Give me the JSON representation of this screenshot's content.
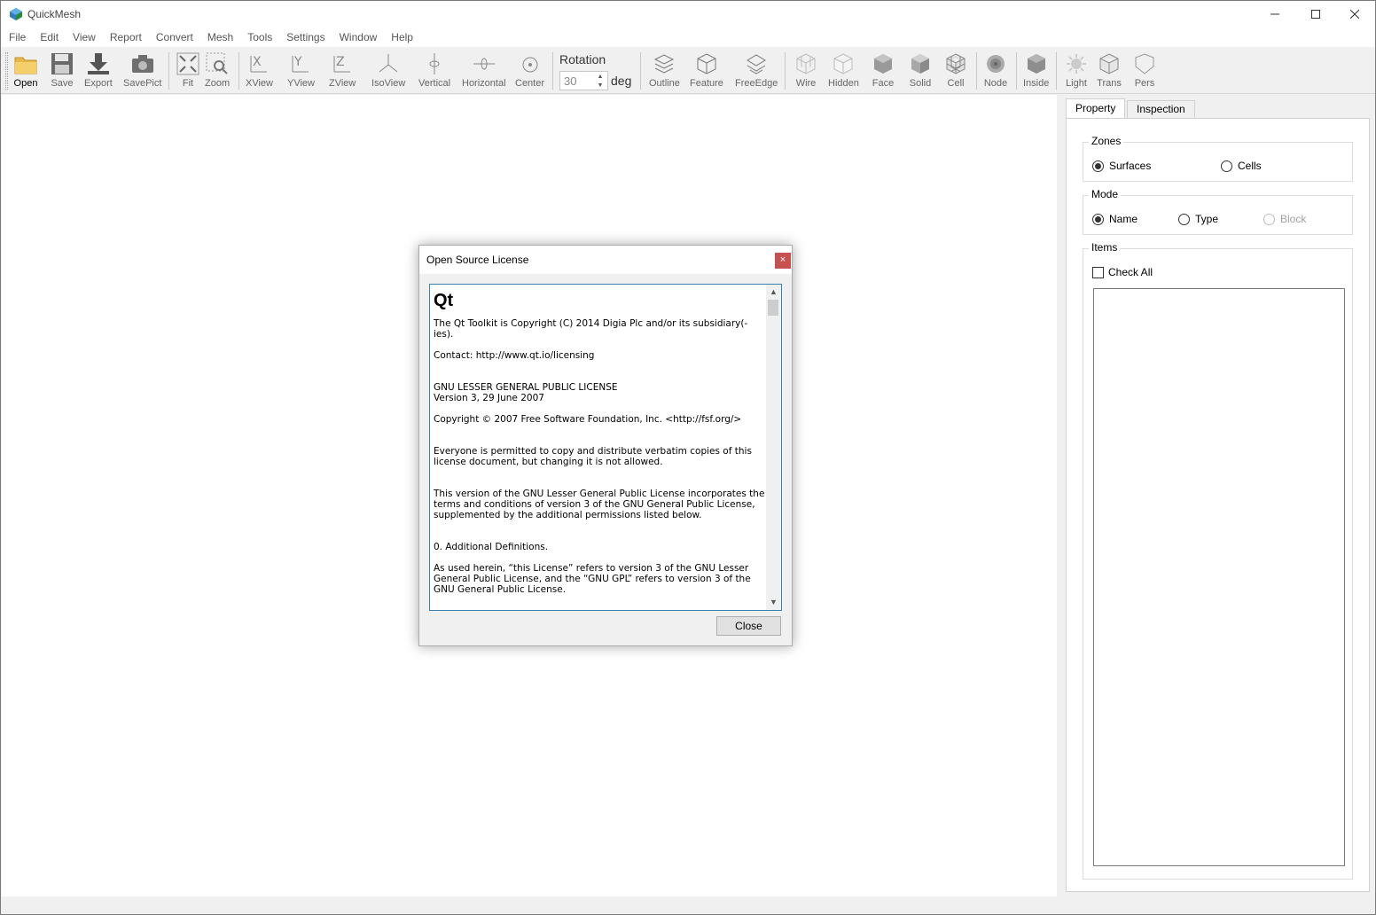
{
  "window": {
    "title": "QuickMesh"
  },
  "menu": [
    "File",
    "Edit",
    "View",
    "Report",
    "Convert",
    "Mesh",
    "Tools",
    "Settings",
    "Window",
    "Help"
  ],
  "toolbar": {
    "open": "Open",
    "save": "Save",
    "export": "Export",
    "savepict": "SavePict",
    "fit": "Fit",
    "zoom": "Zoom",
    "xview": "XView",
    "yview": "YView",
    "zview": "ZView",
    "isoview": "IsoView",
    "vertical": "Vertical",
    "horizontal": "Horizontal",
    "center": "Center",
    "rotation_label": "Rotation",
    "rotation_value": "30",
    "rotation_unit": "deg",
    "outline": "Outline",
    "feature": "Feature",
    "freeedge": "FreeEdge",
    "wire": "Wire",
    "hidden": "Hidden",
    "face": "Face",
    "solid": "Solid",
    "cell": "Cell",
    "node": "Node",
    "inside": "Inside",
    "light": "Light",
    "trans": "Trans",
    "pers": "Pers"
  },
  "panel": {
    "tabs": {
      "property": "Property",
      "inspection": "Inspection"
    },
    "zones": {
      "title": "Zones",
      "surfaces": "Surfaces",
      "cells": "Cells",
      "selected": "Surfaces"
    },
    "mode": {
      "title": "Mode",
      "name": "Name",
      "type": "Type",
      "block": "Block",
      "selected": "Name"
    },
    "items": {
      "title": "Items",
      "check_all": "Check All"
    }
  },
  "dialog": {
    "title": "Open Source License",
    "close_x": "×",
    "heading": "Qt",
    "paragraphs": [
      "The Qt Toolkit is Copyright (C) 2014 Digia Plc and/or its subsidiary(-\nies).",
      "Contact: http://www.qt.io/licensing",
      "GNU LESSER GENERAL PUBLIC LICENSE\nVersion 3, 29 June 2007",
      "Copyright © 2007 Free Software Foundation, Inc. <http://fsf.org/>",
      "Everyone is permitted to copy and distribute verbatim copies of this\nlicense document, but changing it is not allowed.",
      "This version of the GNU Lesser General Public License incorporates the\nterms and conditions of version 3 of the GNU General Public License,\nsupplemented by the additional permissions listed below.",
      "0. Additional Definitions.",
      "As used herein, “this License” refers to version 3 of the GNU Lesser\nGeneral Public License, and the “GNU GPL” refers to version 3 of the\nGNU General Public License."
    ],
    "close_button": "Close"
  },
  "colors": {
    "dialog_close_bg": "#c75050",
    "text_border": "#3c7fb1",
    "app_icon": "#2f7fc0"
  }
}
